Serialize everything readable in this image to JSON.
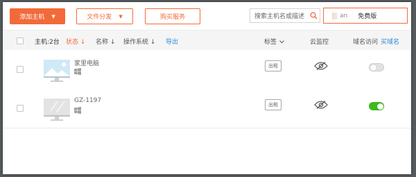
{
  "toolbar": {
    "add_host_label": "添加主机",
    "file_dist_label": "文件分发",
    "buy_service_label": "购买服务",
    "search_placeholder": "搜索主机名或描述",
    "account_user": "an",
    "account_plan": "免费版"
  },
  "header": {
    "host_count": "主机:2台",
    "status": "状态 ↓",
    "name": "名称 ↓",
    "os": "操作系统 ↓",
    "export": "导出",
    "tags": "标签",
    "monitor": "云监控",
    "domain_access": "域名访问",
    "buy_domain": "买域名"
  },
  "rows": [
    {
      "name": "家里电脑",
      "tag_label": "出租",
      "domain_access": false
    },
    {
      "name": "GZ-1197",
      "tag_label": "出租",
      "domain_access": true
    }
  ],
  "colors": {
    "accent": "#f26a3a",
    "link": "#2d8ad8",
    "toggle_on": "#3fb81d"
  },
  "icons": {
    "os": "windows-icon",
    "monitor": "eye-off-icon",
    "search": "search-icon"
  }
}
